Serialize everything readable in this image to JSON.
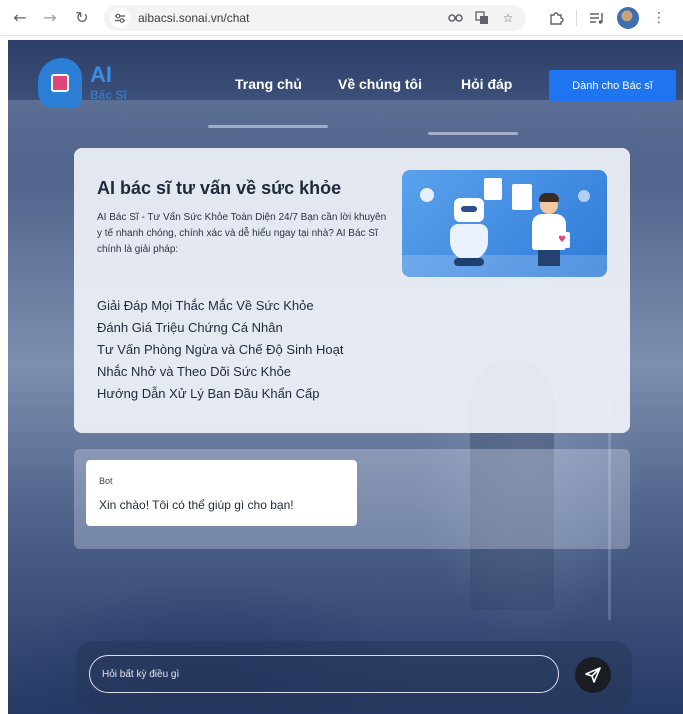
{
  "browser": {
    "url": "aibacsi.sonai.vn/chat",
    "icons": {
      "back": "arrow-left-icon",
      "forward": "arrow-right-icon",
      "reload": "reload-icon",
      "site_info": "site-settings-icon",
      "password": "password-key-icon",
      "translate": "translate-icon",
      "bookmark": "star-icon",
      "extensions": "puzzle-icon",
      "media": "media-queue-icon",
      "profile": "profile-avatar",
      "menu": "kebab-menu-icon"
    }
  },
  "header": {
    "logo_title": "AI",
    "logo_subtitle": "Bác Sĩ",
    "nav": {
      "home": "Trang chủ",
      "about": "Về chúng tôi",
      "faq": "Hỏi đáp"
    },
    "doctor_button": "Dành cho Bác sĩ"
  },
  "info": {
    "title": "AI bác sĩ tư vấn về sức khỏe",
    "description": "AI Bác Sĩ - Tư Vấn Sức Khỏe Toàn Diện 24/7 Bạn cần lời khuyên y tế nhanh chóng, chính xác và dễ hiểu ngay tại nhà? AI Bác Sĩ chính là giải pháp:",
    "features": [
      "Giải Đáp Mọi Thắc Mắc Về Sức Khỏe",
      "Đánh Giá Triệu Chứng Cá Nhân",
      "Tư Vấn Phòng Ngừa và Chế Độ Sinh Hoạt",
      "Nhắc Nhở và Theo Dõi Sức Khỏe",
      "Hướng Dẫn Xử Lý Ban Đầu Khẩn Cấp"
    ]
  },
  "chat": {
    "messages": [
      {
        "sender": "Bot",
        "text": "Xin chào! Tôi có thể giúp gì cho bạn!"
      }
    ],
    "input_value": "",
    "input_placeholder": "Hỏi bất kỳ điều gì",
    "send_icon": "send-paper-plane-icon"
  },
  "colors": {
    "primary_button": "#1f74f0",
    "logo": "#3a8ee8",
    "send_button": "#1a1d24"
  }
}
